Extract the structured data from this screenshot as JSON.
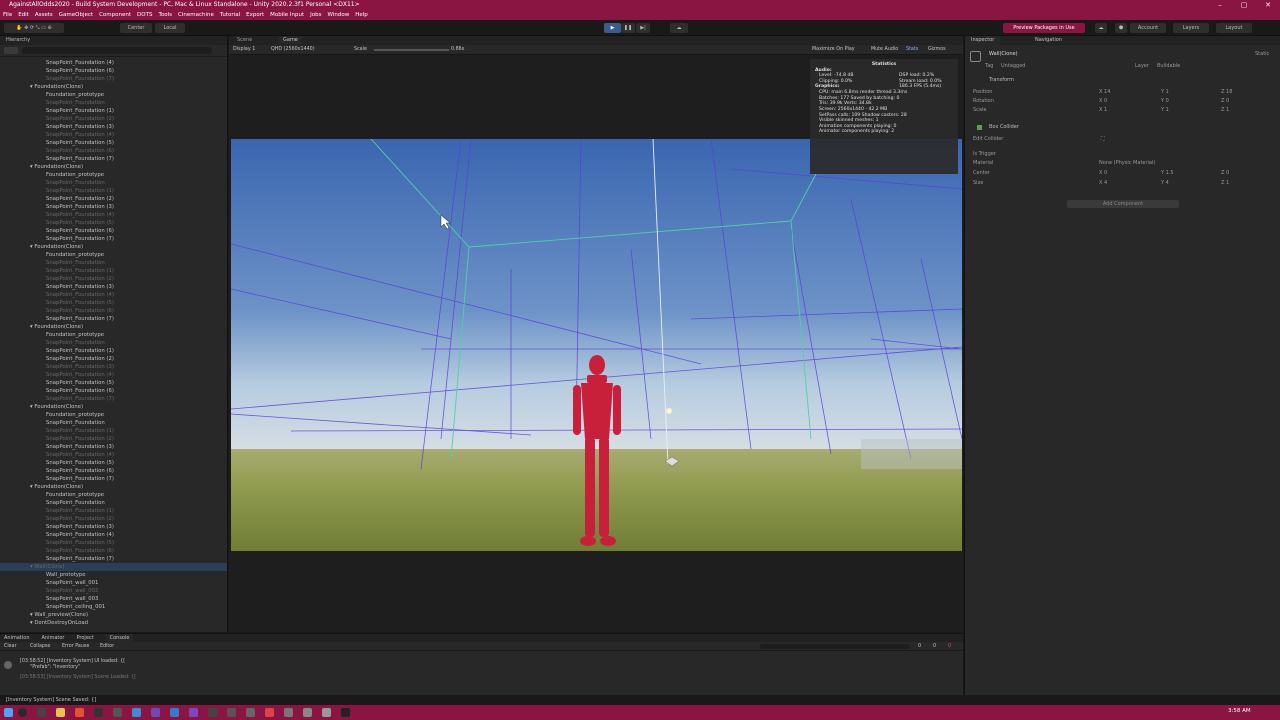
{
  "window": {
    "title": "AgainstAllOdds2020 - Build System Development - PC, Mac & Linux Standalone - Unity 2020.2.3f1 Personal <DX11>"
  },
  "menu": [
    "File",
    "Edit",
    "Assets",
    "GameObject",
    "Component",
    "DOTS",
    "Tools",
    "Cinemachine",
    "Tutorial",
    "Export",
    "Mobile Input",
    "Jobs",
    "Window",
    "Help"
  ],
  "toolbar": {
    "center_label": "Center",
    "local_label": "Local",
    "preview_packages": "Preview Packages in Use",
    "account": "Account",
    "layers": "Layers",
    "layout": "Layout"
  },
  "hierarchy": {
    "tab": "Hierarchy",
    "rows": [
      {
        "text": "SnapPoint_Foundation (4)",
        "indent": 1,
        "dim": false
      },
      {
        "text": "SnapPoint_Foundation (6)",
        "indent": 1,
        "dim": false
      },
      {
        "text": "SnapPoint_Foundation (7)",
        "indent": 1,
        "dim": true
      },
      {
        "text": "Foundation(Clone)",
        "indent": 0,
        "dim": false
      },
      {
        "text": "Foundation_prototype",
        "indent": 1,
        "dim": false
      },
      {
        "text": "SnapPoint_Foundation",
        "indent": 1,
        "dim": true
      },
      {
        "text": "SnapPoint_Foundation (1)",
        "indent": 1,
        "dim": false
      },
      {
        "text": "SnapPoint_Foundation (2)",
        "indent": 1,
        "dim": true
      },
      {
        "text": "SnapPoint_Foundation (3)",
        "indent": 1,
        "dim": false
      },
      {
        "text": "SnapPoint_Foundation (4)",
        "indent": 1,
        "dim": true
      },
      {
        "text": "SnapPoint_Foundation (5)",
        "indent": 1,
        "dim": false
      },
      {
        "text": "SnapPoint_Foundation (6)",
        "indent": 1,
        "dim": true
      },
      {
        "text": "SnapPoint_Foundation (7)",
        "indent": 1,
        "dim": false
      },
      {
        "text": "Foundation(Clone)",
        "indent": 0,
        "dim": false
      },
      {
        "text": "Foundation_prototype",
        "indent": 1,
        "dim": false
      },
      {
        "text": "SnapPoint_Foundation",
        "indent": 1,
        "dim": true
      },
      {
        "text": "SnapPoint_Foundation (1)",
        "indent": 1,
        "dim": true
      },
      {
        "text": "SnapPoint_Foundation (2)",
        "indent": 1,
        "dim": false
      },
      {
        "text": "SnapPoint_Foundation (3)",
        "indent": 1,
        "dim": false
      },
      {
        "text": "SnapPoint_Foundation (4)",
        "indent": 1,
        "dim": true
      },
      {
        "text": "SnapPoint_Foundation (5)",
        "indent": 1,
        "dim": true
      },
      {
        "text": "SnapPoint_Foundation (6)",
        "indent": 1,
        "dim": false
      },
      {
        "text": "SnapPoint_Foundation (7)",
        "indent": 1,
        "dim": false
      },
      {
        "text": "Foundation(Clone)",
        "indent": 0,
        "dim": false
      },
      {
        "text": "Foundation_prototype",
        "indent": 1,
        "dim": false
      },
      {
        "text": "SnapPoint_Foundation",
        "indent": 1,
        "dim": true
      },
      {
        "text": "SnapPoint_Foundation (1)",
        "indent": 1,
        "dim": true
      },
      {
        "text": "SnapPoint_Foundation (2)",
        "indent": 1,
        "dim": true
      },
      {
        "text": "SnapPoint_Foundation (3)",
        "indent": 1,
        "dim": false
      },
      {
        "text": "SnapPoint_Foundation (4)",
        "indent": 1,
        "dim": true
      },
      {
        "text": "SnapPoint_Foundation (5)",
        "indent": 1,
        "dim": true
      },
      {
        "text": "SnapPoint_Foundation (6)",
        "indent": 1,
        "dim": true
      },
      {
        "text": "SnapPoint_Foundation (7)",
        "indent": 1,
        "dim": false
      },
      {
        "text": "Foundation(Clone)",
        "indent": 0,
        "dim": false
      },
      {
        "text": "Foundation_prototype",
        "indent": 1,
        "dim": false
      },
      {
        "text": "SnapPoint_Foundation",
        "indent": 1,
        "dim": true
      },
      {
        "text": "SnapPoint_Foundation (1)",
        "indent": 1,
        "dim": false
      },
      {
        "text": "SnapPoint_Foundation (2)",
        "indent": 1,
        "dim": false
      },
      {
        "text": "SnapPoint_Foundation (3)",
        "indent": 1,
        "dim": true
      },
      {
        "text": "SnapPoint_Foundation (4)",
        "indent": 1,
        "dim": true
      },
      {
        "text": "SnapPoint_Foundation (5)",
        "indent": 1,
        "dim": false
      },
      {
        "text": "SnapPoint_Foundation (6)",
        "indent": 1,
        "dim": false
      },
      {
        "text": "SnapPoint_Foundation (7)",
        "indent": 1,
        "dim": true
      },
      {
        "text": "Foundation(Clone)",
        "indent": 0,
        "dim": false
      },
      {
        "text": "Foundation_prototype",
        "indent": 1,
        "dim": false
      },
      {
        "text": "SnapPoint_Foundation",
        "indent": 1,
        "dim": false
      },
      {
        "text": "SnapPoint_Foundation (1)",
        "indent": 1,
        "dim": true
      },
      {
        "text": "SnapPoint_Foundation (2)",
        "indent": 1,
        "dim": true
      },
      {
        "text": "SnapPoint_Foundation (3)",
        "indent": 1,
        "dim": false
      },
      {
        "text": "SnapPoint_Foundation (4)",
        "indent": 1,
        "dim": true
      },
      {
        "text": "SnapPoint_Foundation (5)",
        "indent": 1,
        "dim": false
      },
      {
        "text": "SnapPoint_Foundation (6)",
        "indent": 1,
        "dim": false
      },
      {
        "text": "SnapPoint_Foundation (7)",
        "indent": 1,
        "dim": false
      },
      {
        "text": "Foundation(Clone)",
        "indent": 0,
        "dim": false
      },
      {
        "text": "Foundation_prototype",
        "indent": 1,
        "dim": false
      },
      {
        "text": "SnapPoint_Foundation",
        "indent": 1,
        "dim": false
      },
      {
        "text": "SnapPoint_Foundation (1)",
        "indent": 1,
        "dim": true
      },
      {
        "text": "SnapPoint_Foundation (2)",
        "indent": 1,
        "dim": true
      },
      {
        "text": "SnapPoint_Foundation (3)",
        "indent": 1,
        "dim": false
      },
      {
        "text": "SnapPoint_Foundation (4)",
        "indent": 1,
        "dim": false
      },
      {
        "text": "SnapPoint_Foundation (5)",
        "indent": 1,
        "dim": true
      },
      {
        "text": "SnapPoint_Foundation (6)",
        "indent": 1,
        "dim": true
      },
      {
        "text": "SnapPoint_Foundation (7)",
        "indent": 1,
        "dim": false
      },
      {
        "text": "Wall(Clone)",
        "indent": 0,
        "dim": true,
        "sel": true
      },
      {
        "text": "Wall_prototype",
        "indent": 1,
        "dim": false
      },
      {
        "text": "SnapPoint_wall_001",
        "indent": 1,
        "dim": false
      },
      {
        "text": "SnapPoint_wall_002",
        "indent": 1,
        "dim": true
      },
      {
        "text": "SnapPoint_wall_003",
        "indent": 1,
        "dim": false
      },
      {
        "text": "SnapPoint_ceiling_001",
        "indent": 1,
        "dim": false
      },
      {
        "text": "Wall_preview(Clone)",
        "indent": 0,
        "dim": false
      },
      {
        "text": "DontDestroyOnLoad",
        "indent": 0,
        "dim": false
      }
    ]
  },
  "view": {
    "scene_tab": "Scene",
    "game_tab": "Game",
    "display": "Display 1",
    "resolution": "QHD (2560x1440)",
    "scale_label": "Scale",
    "scale_value": "0.86x",
    "maximize": "Maximize On Play",
    "mute": "Mute Audio",
    "stats": "Stats",
    "gizmos": "Gizmos"
  },
  "statistics": {
    "title": "Statistics",
    "audio_header": "Audio:",
    "level": "Level: -74.8 dB",
    "clipping": "Clipping: 0.0%",
    "dsp": "DSP load: 0.2%",
    "stream": "Stream load: 0.0%",
    "graphics_header": "Graphics:",
    "fps": "186.3 FPS (5.4ms)",
    "cpu": "CPU: main 6.8ms  render thread 3.3ms",
    "batches": "Batches: 177    Saved by batching: 0",
    "tris": "Tris: 39.9k       Verts: 34.8k",
    "screen": "Screen: 2560x1440 - 42.2 MB",
    "setpass": "SetPass calls: 109   Shadow casters: 28",
    "skinned": "Visible skinned meshes: 1",
    "anim": "Animation components playing: 0",
    "animator": "Animator components playing: 2"
  },
  "inspector": {
    "tab": "Inspector",
    "nav_tab": "Navigation",
    "object_name": "Wall(Clone)",
    "static": "Static",
    "tag_label": "Tag",
    "tag_value": "Untagged",
    "layer_label": "Layer",
    "layer_value": "Buildable",
    "transform": "Transform",
    "position": "Position",
    "rotation": "Rotation",
    "scale": "Scale",
    "pos": [
      "X 14",
      "Y 1",
      "Z 18"
    ],
    "rot": [
      "X 0",
      "Y 0",
      "Z 0"
    ],
    "scl": [
      "X 1",
      "Y 1",
      "Z 1"
    ],
    "box_collider": "Box Collider",
    "edit_collider": "Edit Collider",
    "is_trigger": "Is Trigger",
    "material_label": "Material",
    "material_value": "None (Physic Material)",
    "center_label": "Center",
    "size_label": "Size",
    "center": [
      "X 0",
      "Y 1.5",
      "Z 0"
    ],
    "size": [
      "X 4",
      "Y 4",
      "Z 1"
    ],
    "add_component": "Add Component"
  },
  "console": {
    "tabs": [
      "Animation",
      "Animator",
      "Project",
      "Console"
    ],
    "clear": "Clear",
    "collapse": "Collapse",
    "error_pause": "Error Pause",
    "editor": "Editor",
    "log1a": "[03:58:52] [Inventory System] UI loaded: {[",
    "log1b": "\"Prefab\": \"Inventory\"",
    "log2": "[03:58:53] [Inventory System] Scene Loaded: {[",
    "counts": [
      "0",
      "0",
      "0"
    ]
  },
  "status": {
    "text": "[Inventory System] Scene Saved: {]"
  },
  "taskbar": {
    "time": "3:58 AM"
  },
  "colors": {
    "titlebar": "#8a1442",
    "sky_top": "#3f6bb3",
    "ground": "#8c9a4a",
    "character": "#c8203a"
  }
}
